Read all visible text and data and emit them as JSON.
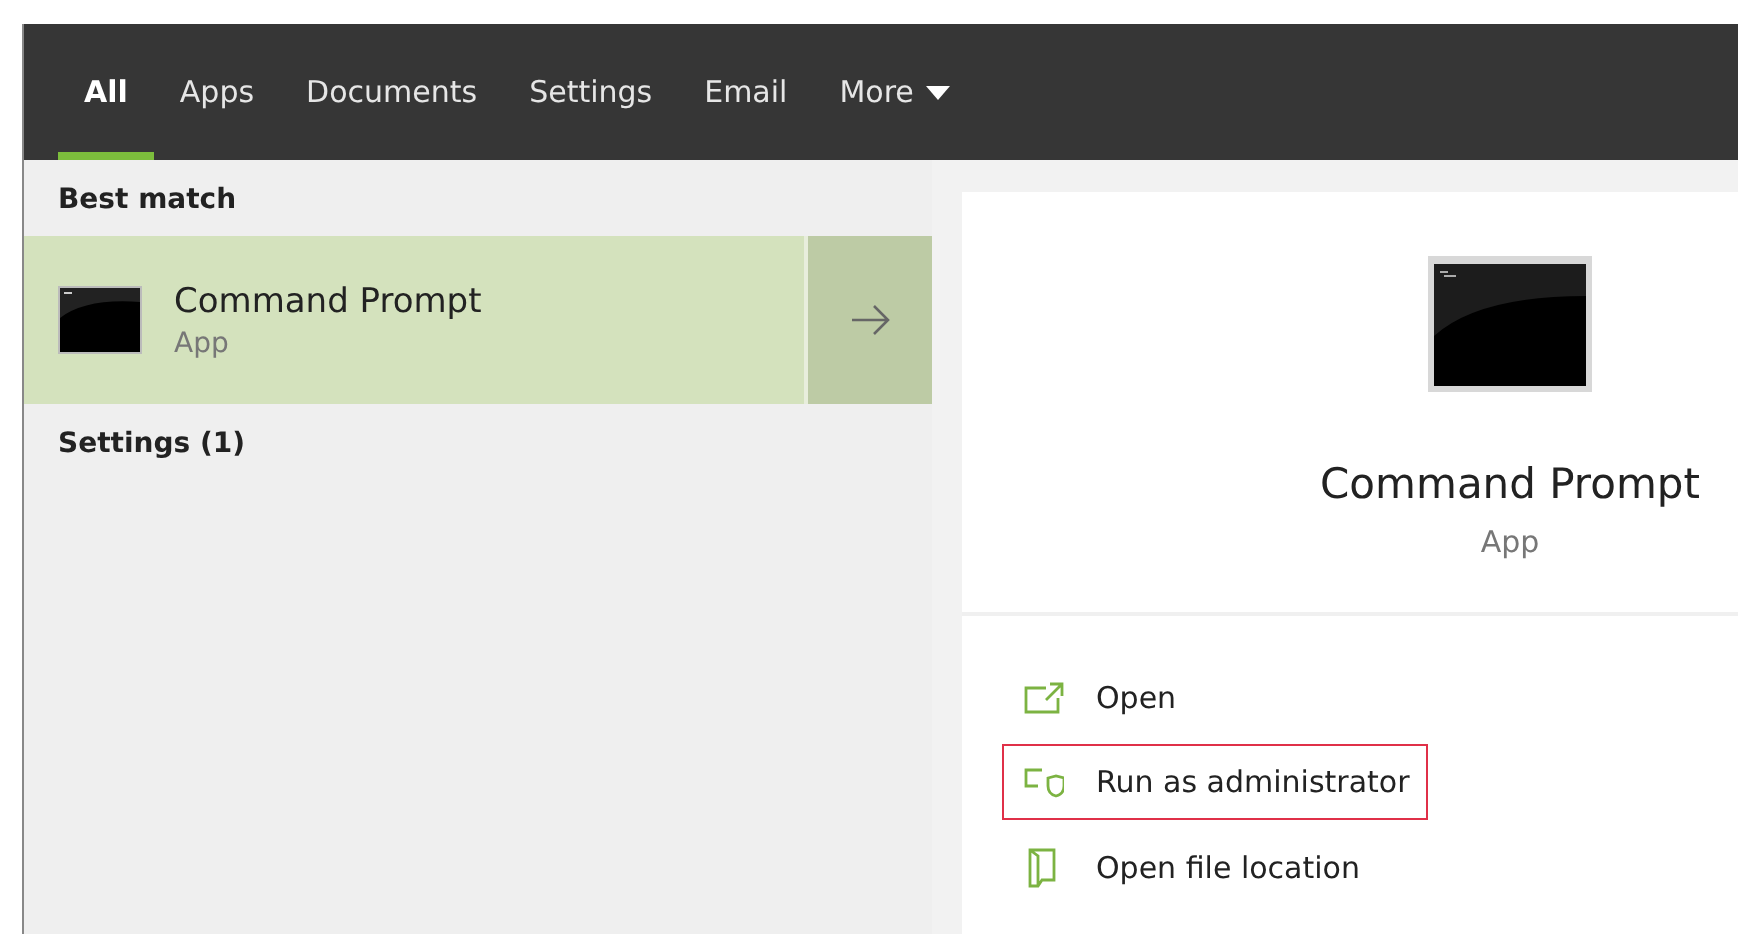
{
  "tabs": [
    {
      "label": "All",
      "selected": true
    },
    {
      "label": "Apps",
      "selected": false
    },
    {
      "label": "Documents",
      "selected": false
    },
    {
      "label": "Settings",
      "selected": false
    },
    {
      "label": "Email",
      "selected": false
    },
    {
      "label": "More",
      "selected": false,
      "dropdown": true
    }
  ],
  "results": {
    "best_match_heading": "Best match",
    "best_match": {
      "name": "Command Prompt",
      "type": "App",
      "selected": true
    },
    "settings_heading": "Settings (1)"
  },
  "preview": {
    "name": "Command Prompt",
    "type": "App"
  },
  "actions": [
    {
      "kind": "open",
      "label": "Open",
      "highlighted": false
    },
    {
      "kind": "admin",
      "label": "Run as administrator",
      "highlighted": true
    },
    {
      "kind": "location",
      "label": "Open file location",
      "highlighted": false
    }
  ]
}
